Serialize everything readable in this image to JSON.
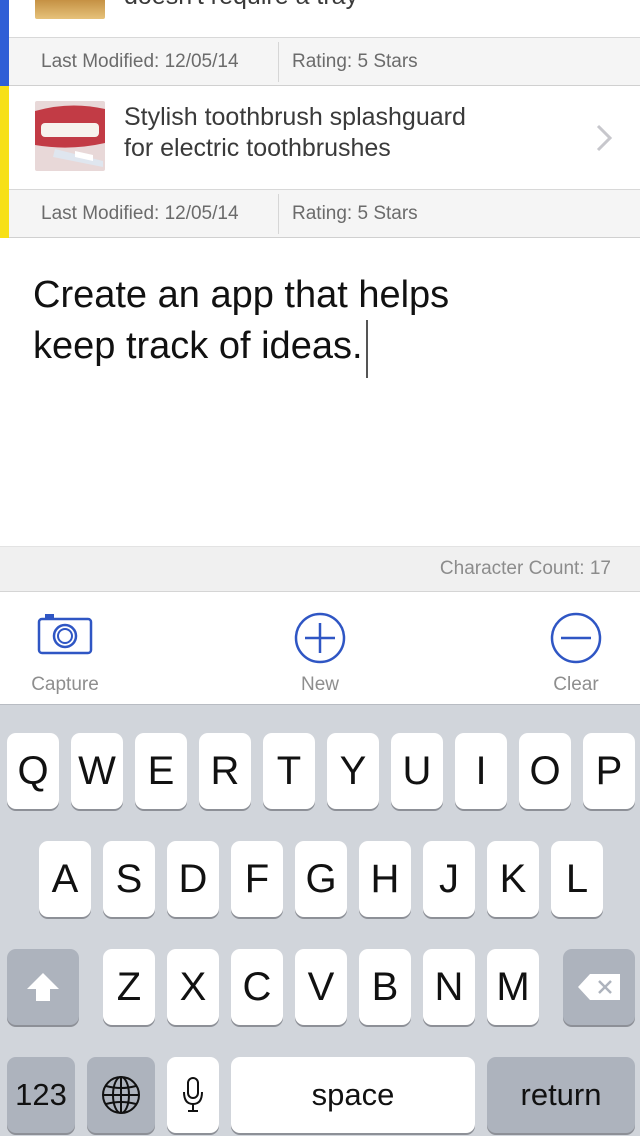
{
  "ideas": [
    {
      "title_line1": "",
      "title_line2": "doesn't require a tray",
      "last_modified": "Last Modified: 12/05/14",
      "rating": "Rating: 5 Stars",
      "accent_color": "#2f5fd6"
    },
    {
      "title_line1": "Stylish toothbrush splashguard",
      "title_line2": "for electric toothbrushes",
      "last_modified": "Last Modified: 12/05/14",
      "rating": "Rating: 5 Stars",
      "accent_color": "#f7e017"
    }
  ],
  "editor": {
    "text_line1": "Create an app that helps",
    "text_line2": "keep track of ideas."
  },
  "character_count": "Character Count: 17",
  "toolbar": {
    "capture_label": "Capture",
    "capture_icon": "camera-icon",
    "new_label": "New",
    "new_icon": "plus-circle-icon",
    "clear_label": "Clear",
    "clear_icon": "minus-circle-icon"
  },
  "keyboard": {
    "row1": [
      "Q",
      "W",
      "E",
      "R",
      "T",
      "Y",
      "U",
      "I",
      "O",
      "P"
    ],
    "row2": [
      "A",
      "S",
      "D",
      "F",
      "G",
      "H",
      "J",
      "K",
      "L"
    ],
    "row3": [
      "Z",
      "X",
      "C",
      "V",
      "B",
      "N",
      "M"
    ],
    "numbers_key": "123",
    "space_key": "space",
    "return_key": "return"
  },
  "colors": {
    "accent_blue": "#2f5fd6",
    "accent_yellow": "#f7e017",
    "tool_blue": "#2f56c4"
  }
}
